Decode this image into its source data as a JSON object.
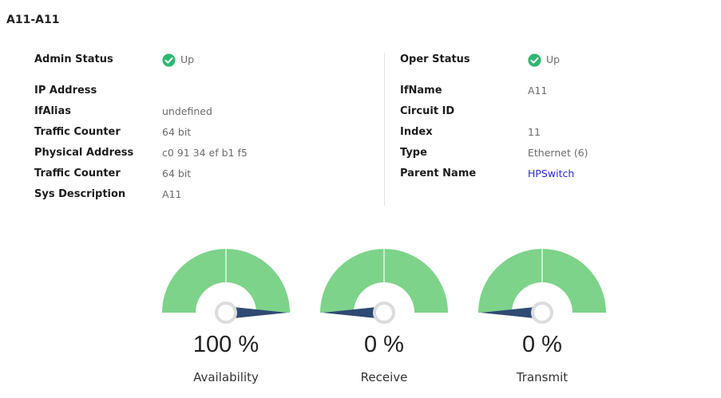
{
  "title": "A11-A11",
  "left_panel": {
    "admin_status": {
      "label": "Admin Status",
      "value": "Up"
    },
    "rows": [
      {
        "label": "IP Address",
        "value": ""
      },
      {
        "label": "IfAlias",
        "value": "undefined"
      },
      {
        "label": "Traffic Counter",
        "value": "64 bit"
      },
      {
        "label": "Physical Address",
        "value": "c0 91 34 ef b1 f5"
      },
      {
        "label": "Traffic Counter",
        "value": "64 bit"
      },
      {
        "label": "Sys Description",
        "value": "A11"
      }
    ]
  },
  "right_panel": {
    "oper_status": {
      "label": "Oper Status",
      "value": "Up"
    },
    "rows": [
      {
        "label": "IfName",
        "value": "A11"
      },
      {
        "label": "Circuit ID",
        "value": ""
      },
      {
        "label": "Index",
        "value": "11"
      },
      {
        "label": "Type",
        "value": "Ethernet (6)"
      },
      {
        "label": "Parent Name",
        "value": "HPSwitch"
      }
    ]
  },
  "gauges": [
    {
      "label": "Availability",
      "value_text": "100 %",
      "percent": 100
    },
    {
      "label": "Receive",
      "value_text": "0 %",
      "percent": 0
    },
    {
      "label": "Transmit",
      "value_text": "0 %",
      "percent": 0
    }
  ],
  "colors": {
    "status_up": "#2eb872",
    "gauge_fill": "#7dd38a",
    "needle": "#2f4a73",
    "hub": "#dcdcdc",
    "link": "#2a2acd"
  },
  "icons": {
    "status": "check-circle-icon"
  }
}
